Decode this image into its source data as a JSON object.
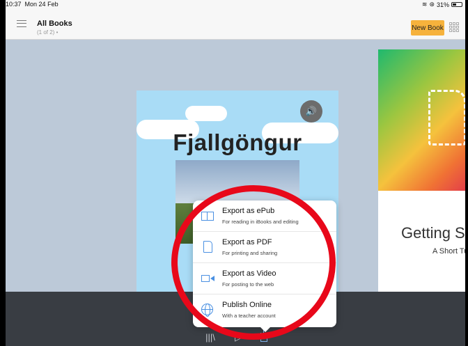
{
  "status_bar": {
    "time": "10:37",
    "date": "Mon 24 Feb",
    "battery": "31%"
  },
  "nav": {
    "title": "All Books",
    "subtitle": "(1 of 2) •",
    "new_book_label": "New Book"
  },
  "books": [
    {
      "title": "Fjallgöngur",
      "subtitle": ""
    },
    {
      "title": "Getting S",
      "subtitle": "A Short Tu"
    }
  ],
  "export_menu": {
    "items": [
      {
        "title": "Export as ePub",
        "subtitle": "For reading in iBooks and editing",
        "icon": "book-icon"
      },
      {
        "title": "Export as PDF",
        "subtitle": "For printing and sharing",
        "icon": "document-icon"
      },
      {
        "title": "Export as Video",
        "subtitle": "For posting to the web",
        "icon": "video-camera-icon"
      },
      {
        "title": "Publish Online",
        "subtitle": "With a teacher account",
        "icon": "globe-icon"
      }
    ]
  },
  "colors": {
    "accent": "#f6b23c",
    "highlight": "#e8081a",
    "menu_icon": "#4a90e2"
  }
}
